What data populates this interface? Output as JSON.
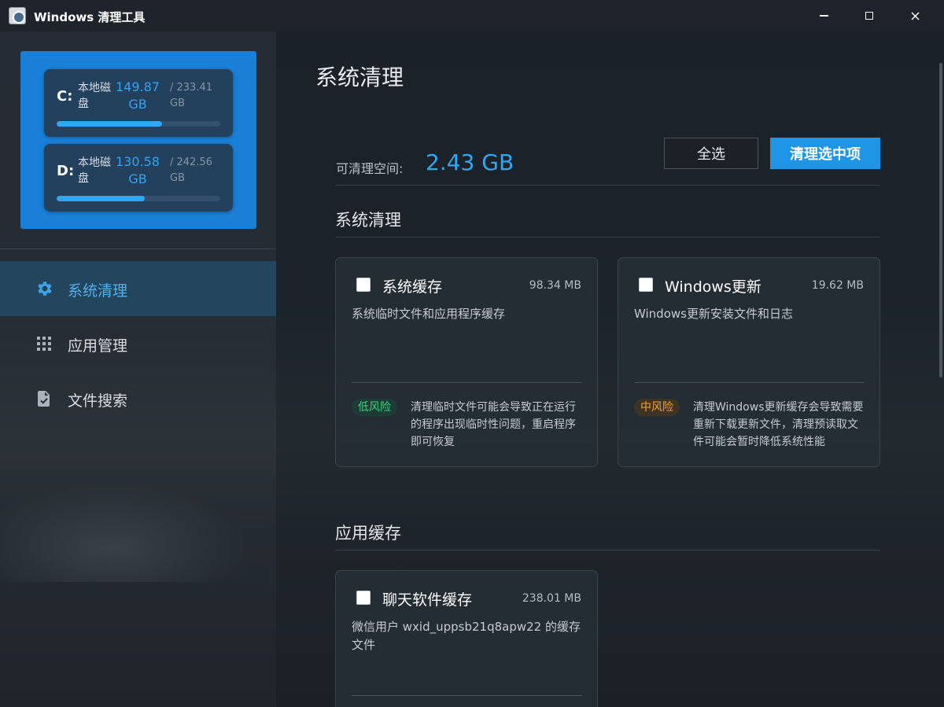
{
  "window": {
    "title": "Windows 清理工具",
    "controls": {
      "minimize": "—",
      "maximize": "□",
      "close": "✕"
    }
  },
  "disks": [
    {
      "letter": "C:",
      "name": "本地磁盘",
      "used": "149.87 GB",
      "total": "/ 233.41 GB",
      "usage_fraction": 0.642
    },
    {
      "letter": "D:",
      "name": "本地磁盘",
      "used": "130.58 GB",
      "total": "/ 242.56 GB",
      "usage_fraction": 0.538
    }
  ],
  "nav": [
    {
      "label": "系统清理",
      "icon": "gear-icon",
      "active": true
    },
    {
      "label": "应用管理",
      "icon": "grid-icon",
      "active": false
    },
    {
      "label": "文件搜索",
      "icon": "file-check-icon",
      "active": false
    }
  ],
  "main": {
    "title": "系统清理",
    "space_label": "可清理空间:",
    "space_value": "2.43 GB",
    "select_all_label": "全选",
    "clean_selected_label": "清理选中项"
  },
  "sections": [
    {
      "title": "系统清理",
      "cards": [
        {
          "title": "系统缓存",
          "size": "98.34 MB",
          "checked": false,
          "description": "系统临时文件和应用程序缓存",
          "risk": "低风险",
          "risk_level": "low",
          "risk_text": "清理临时文件可能会导致正在运行的程序出现临时性问题，重启程序即可恢复"
        },
        {
          "title": "Windows更新",
          "size": "19.62 MB",
          "checked": false,
          "description": "Windows更新安装文件和日志",
          "risk": "中风险",
          "risk_level": "medium",
          "risk_text": "清理Windows更新缓存会导致需要重新下载更新文件，清理预读取文件可能会暂时降低系统性能"
        }
      ]
    },
    {
      "title": "应用缓存",
      "cards": [
        {
          "title": "聊天软件缓存",
          "size": "238.01 MB",
          "checked": false,
          "description": "微信用户 wxid_uppsb21q8apw22 的缓存文件"
        }
      ]
    }
  ],
  "colors": {
    "accent": "#1f95e8",
    "disk_panel": "#1a7fd6",
    "risk_low": "#3dd17e",
    "risk_medium": "#f0a333"
  }
}
